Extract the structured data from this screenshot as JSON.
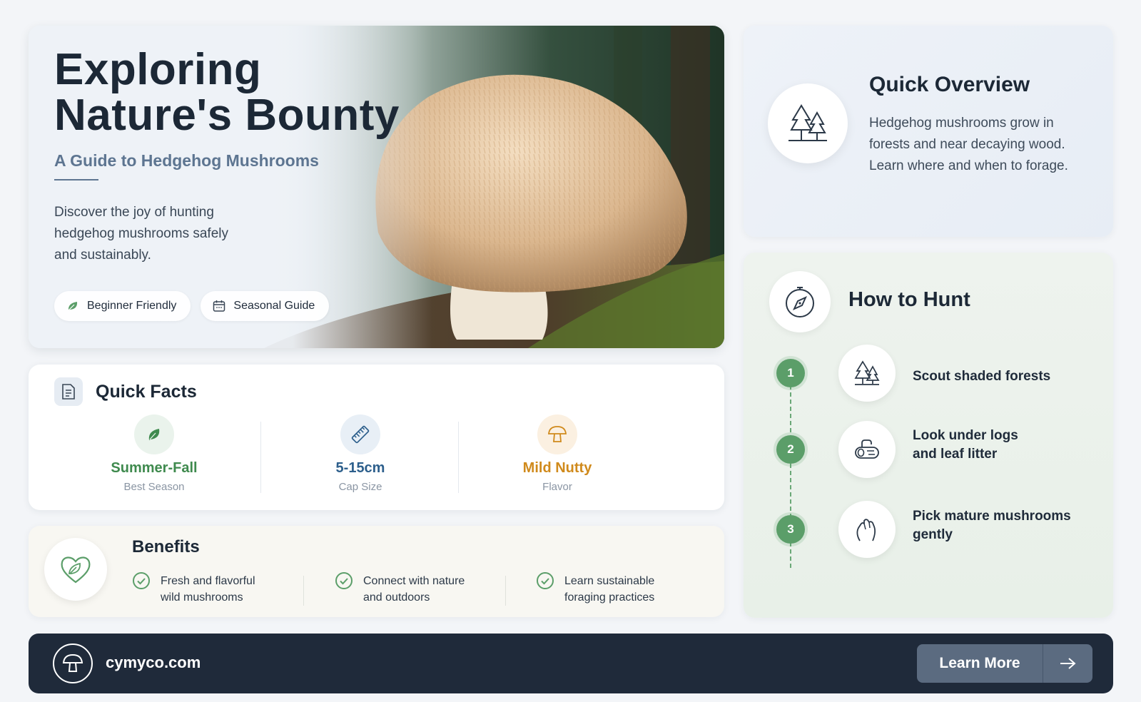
{
  "hero": {
    "title_line1": "Exploring",
    "title_line2": "Nature's Bounty",
    "subtitle": "A Guide to Hedgehog Mushrooms",
    "description": "Discover the joy of hunting hedgehog mushrooms safely and sustainably.",
    "pills": [
      {
        "label": "Beginner Friendly",
        "icon": "leaf-icon"
      },
      {
        "label": "Seasonal Guide",
        "icon": "calendar-icon"
      }
    ]
  },
  "quick_facts": {
    "title": "Quick Facts",
    "icon": "document-icon",
    "items": [
      {
        "value": "Summer-Fall",
        "label": "Best Season",
        "icon": "leaf-icon",
        "color": "#3f8a4e",
        "bg": "#eaf3ec"
      },
      {
        "value": "5-15cm",
        "label": "Cap Size",
        "icon": "ruler-icon",
        "color": "#2d5f8c",
        "bg": "#e8eff6"
      },
      {
        "value": "Mild Nutty",
        "label": "Flavor",
        "icon": "mushroom-icon",
        "color": "#d08a1c",
        "bg": "#fbf0e1"
      }
    ]
  },
  "benefits": {
    "title": "Benefits",
    "icon": "heart-leaf-icon",
    "items": [
      {
        "line1": "Fresh and flavorful",
        "line2": "wild mushrooms"
      },
      {
        "line1": "Connect with nature",
        "line2": "and outdoors"
      },
      {
        "line1": "Learn sustainable",
        "line2": "foraging practices"
      }
    ]
  },
  "overview": {
    "title": "Quick Overview",
    "icon": "trees-icon",
    "text": "Hedgehog mushrooms grow in forests and near decaying wood. Learn where and when to forage."
  },
  "hunt": {
    "title": "How to Hunt",
    "icon": "compass-icon",
    "steps": [
      {
        "num": "1",
        "line1": "Scout shaded forests",
        "line2": "",
        "icon": "trees-icon"
      },
      {
        "num": "2",
        "line1": "Look under logs",
        "line2": "and leaf litter",
        "icon": "log-icon"
      },
      {
        "num": "3",
        "line1": "Pick mature mushrooms",
        "line2": "gently",
        "icon": "hand-icon"
      }
    ]
  },
  "footer": {
    "site": "cymyco.com",
    "button_label": "Learn More",
    "logo_icon": "mushroom-icon",
    "arrow_icon": "arrow-right-icon"
  },
  "colors": {
    "accent_green": "#5b9e69",
    "dark_navy": "#1f2a3a",
    "slate_blue": "#5d7591"
  }
}
